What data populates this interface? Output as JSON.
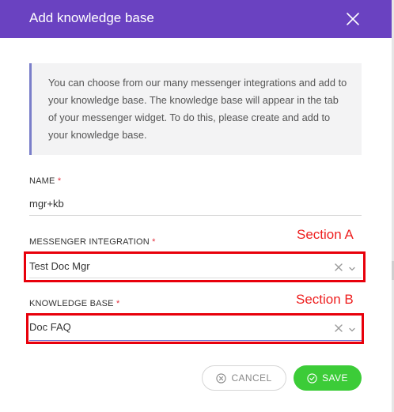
{
  "modal": {
    "title": "Add knowledge base",
    "info_text": "You can choose from our many messenger integrations and add to your knowledge base. The knowledge base will appear in the tab of your messenger widget. To do this, please create and add to your knowledge base."
  },
  "fields": {
    "name": {
      "label": "NAME",
      "required_mark": "*",
      "value": "mgr+kb"
    },
    "messenger_integration": {
      "label": "MESSENGER INTEGRATION",
      "required_mark": "*",
      "value": "Test Doc Mgr"
    },
    "knowledge_base": {
      "label": "KNOWLEDGE BASE",
      "required_mark": "*",
      "value": "Doc FAQ"
    }
  },
  "annotations": {
    "section_a": "Section A",
    "section_b": "Section B"
  },
  "buttons": {
    "cancel": "CANCEL",
    "save": "SAVE"
  },
  "colors": {
    "header": "#6a42c1",
    "save": "#3ccc38",
    "required": "#e2313f",
    "annotation": "#e8000b"
  },
  "icons": {
    "close": "close-icon",
    "clear": "clear-icon",
    "chevron": "chevron-down-icon",
    "cancel": "cancel-circle-icon",
    "save": "check-circle-icon"
  }
}
